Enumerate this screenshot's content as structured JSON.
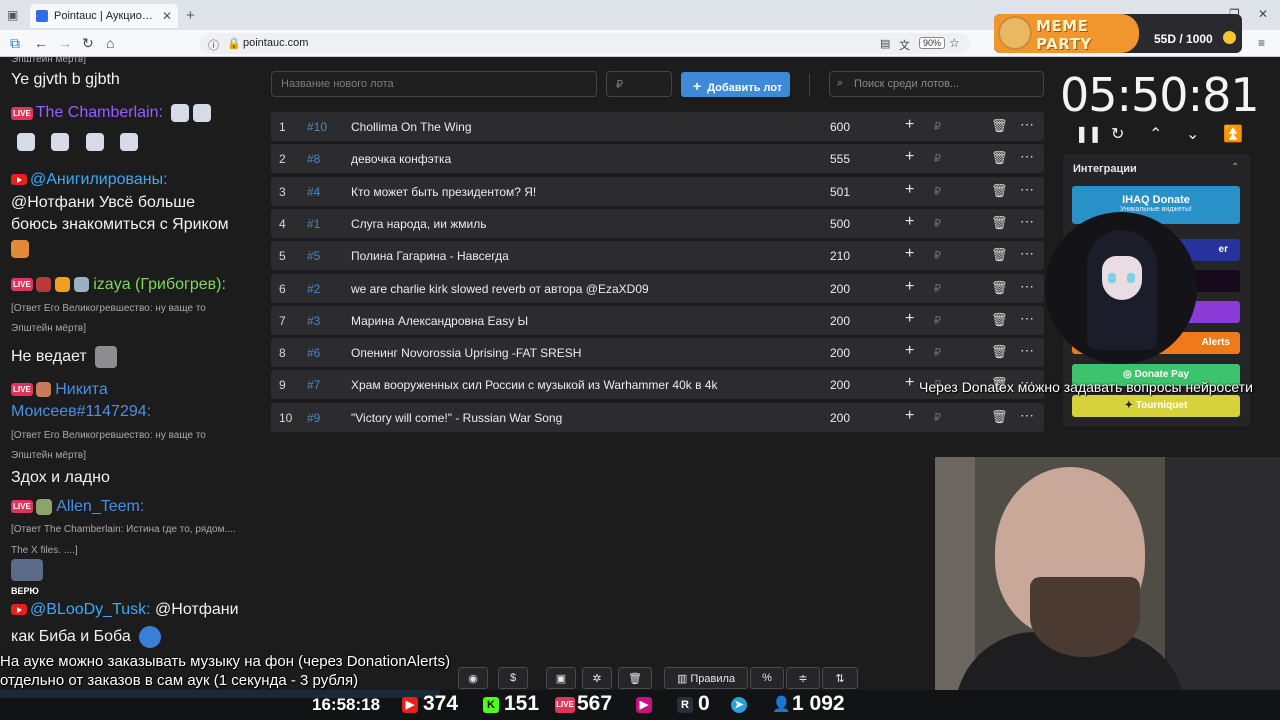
{
  "browser": {
    "tab_title": "Pointauc | Аукцион для стримеров",
    "url": "pointauc.com",
    "zoom": "90%"
  },
  "banner": {
    "logo_text": "MEME PARTY",
    "score": "55D / 1000"
  },
  "chat": {
    "lines": [
      {
        "text": "Эпштейн мёртв]",
        "style": "small"
      },
      {
        "text": "Ye gjvth b gjbth",
        "style": "big"
      },
      {
        "author": "The Chamberlain:",
        "author_color": "#9b5cff",
        "badge": "live"
      },
      {
        "author": "@Анигилированы:",
        "author_color": "#3fa9f5",
        "badge": "yt"
      },
      {
        "text": "@Нотфани Увсё больше",
        "style": "big"
      },
      {
        "text": "боюсь знакомиться с Яриком",
        "style": "big"
      },
      {
        "author": "izaya (Грибогрев):",
        "author_color": "#7ed957",
        "badge": "live"
      },
      {
        "text": "[Ответ Его Великогревшество: ну ваще то",
        "style": "small"
      },
      {
        "text": "Эпштейн мёртв]",
        "style": "small"
      },
      {
        "text": "Не ведает",
        "style": "big"
      },
      {
        "author": "Никита",
        "author_color": "#4a90e2",
        "badge": "live"
      },
      {
        "text": "Моисеев#1147294:",
        "style": "author",
        "color": "#4a90e2"
      },
      {
        "text": "[Ответ Его Великогревшество: ну ваще то",
        "style": "small"
      },
      {
        "text": "Эпштейн мёртв]",
        "style": "small"
      },
      {
        "text": "Здох и ладно",
        "style": "big"
      },
      {
        "author": "Allen_Teem:",
        "author_color": "#4a90e2",
        "badge": "live"
      },
      {
        "text": "[Ответ The Chamberlain: Истина где то, рядом....",
        "style": "small"
      },
      {
        "text": "The X files. ....]",
        "style": "small"
      },
      {
        "text": "ВЕРЮ",
        "style": "emote-label"
      },
      {
        "author": "@BLooDy_Tusk:",
        "author_color": "#3fa9f5",
        "badge": "yt",
        "rest": " @Нотфани"
      },
      {
        "text": "как Биба и Боба",
        "style": "big"
      }
    ]
  },
  "auction": {
    "new_lot_placeholder": "Название нового лота",
    "amount_placeholder": "₽",
    "add_button": "Добавить лот",
    "search_placeholder": "Поиск среди лотов...",
    "lots": [
      {
        "n": "1",
        "id": "#10",
        "name": "Chollima On The Wing",
        "amount": "600"
      },
      {
        "n": "2",
        "id": "#8",
        "name": "девочка конфэтка",
        "amount": "555"
      },
      {
        "n": "3",
        "id": "#4",
        "name": "Кто может быть президентом? Я!",
        "amount": "501"
      },
      {
        "n": "4",
        "id": "#1",
        "name": "Слуга народа, ии жмиль",
        "amount": "500"
      },
      {
        "n": "5",
        "id": "#5",
        "name": "Полина Гагарина - Навсегда",
        "amount": "210"
      },
      {
        "n": "6",
        "id": "#2",
        "name": "we are charlie kirk slowed reverb от автора @EzaXD09",
        "amount": "200"
      },
      {
        "n": "7",
        "id": "#3",
        "name": "Марина Александровна Easy Ы",
        "amount": "200"
      },
      {
        "n": "8",
        "id": "#6",
        "name": "Опенинг Novorossia Uprising -FAT SRESH",
        "amount": "200"
      },
      {
        "n": "9",
        "id": "#7",
        "name": "Храм вооруженных сил России с музыкой из Warhammer 40k в 4k",
        "amount": "200"
      },
      {
        "n": "10",
        "id": "#9",
        "name": "\"Victory will come!\" - Russian War Song",
        "amount": "200"
      }
    ],
    "currency": "₽"
  },
  "timer": {
    "value": "05:50:81"
  },
  "integrations": {
    "title": "Интеграции",
    "ihaq_label": "IHAQ Donate",
    "ihaq_sub": "Уникальные виджеты!",
    "partial_1": "er",
    "alerts_label": "Alerts",
    "donatepay_label": "Donate Pay",
    "tourniquet_label": "Tourniquet"
  },
  "overlays": {
    "donatex_msg": "Через Donatex можно задавать вопросы нейросети",
    "music_line1": "На ауке можно заказывать музыку на фон (через DonationAlerts)",
    "music_line2": "отдельно от заказов в сам аук (1 секунда - 3 рубля)"
  },
  "toolbar": {
    "rules_label": "Правила",
    "percent_label": "%"
  },
  "stats": {
    "clock": "16:58:18",
    "youtube": "374",
    "kick": "151",
    "vk": "567",
    "rutube": "0",
    "telegram": "",
    "total": "1 092"
  },
  "colors": {
    "accent": "#3d8bd8",
    "ihaq": "#2a90c8",
    "donatepay": "#3cc46c",
    "tourniquet": "#d6d23c",
    "alerts": "#f07a1a",
    "purple": "#8a3ad6"
  }
}
